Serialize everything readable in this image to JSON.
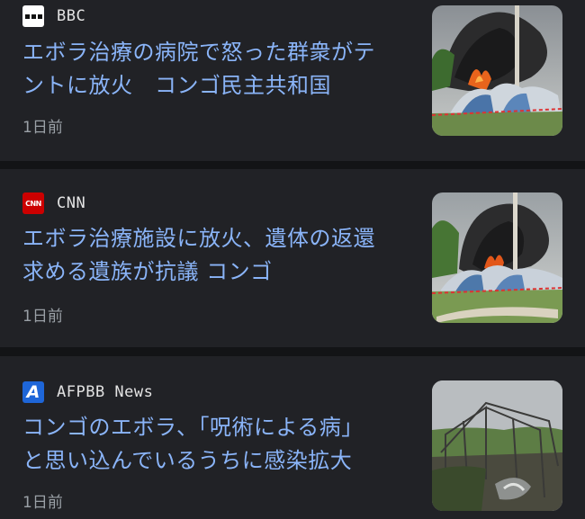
{
  "articles": [
    {
      "source": "BBC",
      "logo": "bbc-logo-icon",
      "headline": "エボラ治療の病院で怒った群衆がテ\nントに放火　コンゴ民主共和国",
      "time": "1日前",
      "thumbnail": "burning-tents-photo"
    },
    {
      "source": "CNN",
      "logo_text": "CNN",
      "logo": "cnn-logo-icon",
      "headline": "エボラ治療施設に放火、遺体の返還\n求める遺族が抗議 コンゴ",
      "time": "1日前",
      "thumbnail": "burning-tents-photo"
    },
    {
      "source": "AFPBB News",
      "logo_text": "A",
      "logo": "afpbb-logo-icon",
      "headline": "コンゴのエボラ、「呪術による病」\nと思い込んでいるうちに感染拡大",
      "time": "1日前",
      "thumbnail": "burned-tent-frames-photo"
    }
  ],
  "colors": {
    "background": "#131416",
    "card": "#212226",
    "headline": "#8ab4f8",
    "source": "#e3e3e3",
    "time": "#9aa0a6"
  }
}
